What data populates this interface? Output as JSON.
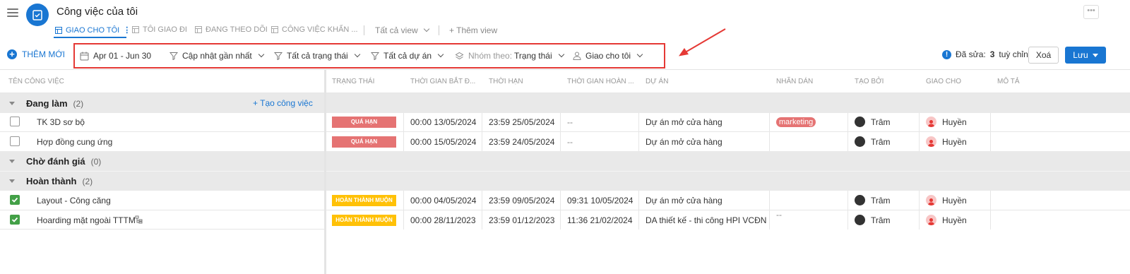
{
  "header": {
    "title": "Công việc của tôi",
    "tabs": [
      {
        "label": "GIAO CHO TÔI",
        "active": true
      },
      {
        "label": "TÔI GIAO ĐI"
      },
      {
        "label": "ĐANG THEO DÕI"
      },
      {
        "label": "CÔNG VIỆC KHẨN ..."
      }
    ],
    "view_dropdown": "Tất cả view",
    "add_view": "+ Thêm view",
    "more": "•••"
  },
  "toolbar": {
    "add_new": "THÊM MỚI",
    "filters": {
      "date_range": "Apr 01 - Jun 30",
      "sort": "Cập nhật gần nhất",
      "status": "Tất cả trạng thái",
      "project": "Tất cả dự án",
      "group_prefix": "Nhóm theo:",
      "group_value": "Trạng thái",
      "assigned": "Giao cho tôi"
    },
    "edited_prefix": "Đã sửa:",
    "edited_count": "3",
    "edited_suffix": "tuỳ chỉnh",
    "delete_label": "Xoá",
    "save_label": "Lưu"
  },
  "columns": {
    "name": "TÊN CÔNG VIỆC",
    "status": "TRẠNG THÁI",
    "start": "THỜI GIAN BẮT Đ...",
    "deadline": "THỜI HẠN",
    "finish": "THỜI GIAN HOÀN ...",
    "project": "DỰ ÁN",
    "labels": "NHÃN DÁN",
    "creator": "TẠO BỞI",
    "assignee": "GIAO CHO",
    "desc": "MÔ TẢ"
  },
  "groups": [
    {
      "name": "Đang làm",
      "count": "(2)",
      "create_label": "+ Tạo công việc"
    },
    {
      "name": "Chờ đánh giá",
      "count": "(0)"
    },
    {
      "name": "Hoàn thành",
      "count": "(2)"
    }
  ],
  "tasks": [
    {
      "name": "TK 3D sơ bộ",
      "status": "QUÁ HẠN",
      "start": "00:00 13/05/2024",
      "deadline": "23:59 25/05/2024",
      "finish": "--",
      "project": "Dự án mở cửa hàng",
      "label": "marketing",
      "creator": "Trâm",
      "assignee": "Huyền",
      "done": false
    },
    {
      "name": "Hợp đồng cung ứng",
      "status": "QUÁ HẠN",
      "start": "00:00 15/05/2024",
      "deadline": "23:59 24/05/2024",
      "finish": "--",
      "project": "Dự án mở cửa hàng",
      "label": "",
      "creator": "Trâm",
      "assignee": "Huyền",
      "done": false
    },
    {
      "name": "Layout - Công căng",
      "status": "HOÀN THÀNH MUỘN",
      "start": "00:00 04/05/2024",
      "deadline": "23:59 09/05/2024",
      "finish": "09:31 10/05/2024",
      "project": "Dự án mở cửa hàng",
      "label": "",
      "creator": "Trâm",
      "assignee": "Huyền",
      "done": true
    },
    {
      "name": "Hoarding mặt ngoài TTTM",
      "status": "HOÀN THÀNH MUỘN",
      "start": "00:00 28/11/2023",
      "deadline": "23:59 01/12/2023",
      "finish": "11:36 21/02/2024",
      "project": "DA thiết kế - thi công HPI VCĐN",
      "label": "--",
      "creator": "Trâm",
      "assignee": "Huyền",
      "done": true
    }
  ],
  "colors": {
    "accent": "#1976d2",
    "overdue": "#e57373",
    "late_done": "#ffc107",
    "highlight": "#e53935",
    "done_check": "#43a047"
  }
}
